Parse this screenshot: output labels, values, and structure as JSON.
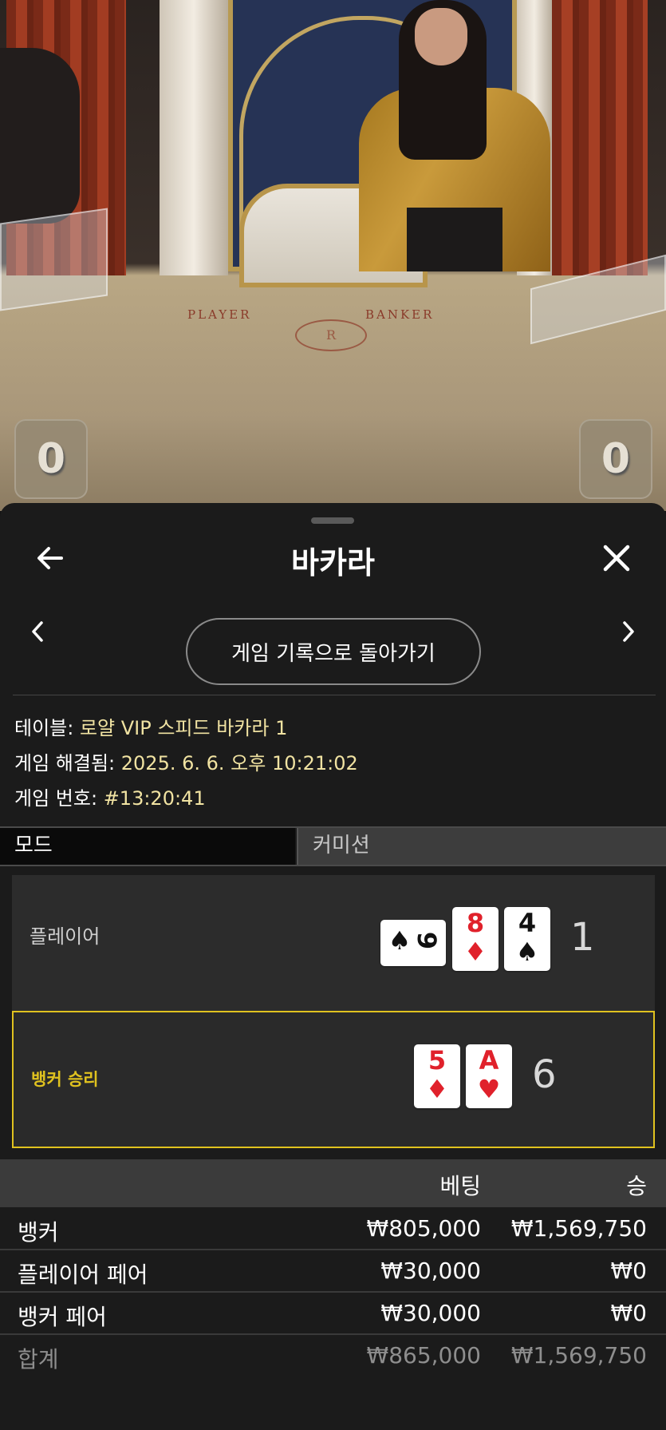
{
  "video": {
    "felt_player": "PLAYER",
    "felt_banker": "BANKER",
    "felt_logo": "R",
    "player_score": "0",
    "banker_score": "0"
  },
  "header": {
    "title": "바카라",
    "back_icon": "arrow-left-icon",
    "close_icon": "close-icon"
  },
  "navigation": {
    "prev_icon": "chevron-left-icon",
    "next_icon": "chevron-right-icon",
    "back_to_history_label": "게임 기록으로 돌아가기"
  },
  "info": {
    "table_key": "테이블:",
    "table_value": "로얄 VIP 스피드 바카라 1",
    "resolved_key": "게임 해결됨:",
    "resolved_value": "2025. 6. 6. 오후 10:21:02",
    "number_key": "게임 번호:",
    "number_value": "#13:20:41"
  },
  "tabs": {
    "mode": "모드",
    "commission": "커미션"
  },
  "hands": {
    "player": {
      "label": "플레이어",
      "score": "1",
      "cards": [
        {
          "rank": "9",
          "suit": "♠",
          "color": "#111111",
          "orientation": "sideways"
        },
        {
          "rank": "8",
          "suit": "♦",
          "color": "#e0212b"
        },
        {
          "rank": "4",
          "suit": "♠",
          "color": "#111111"
        }
      ]
    },
    "banker": {
      "label": "뱅커 승리",
      "score": "6",
      "label_color": "#e0c21f",
      "cards": [
        {
          "rank": "5",
          "suit": "♦",
          "color": "#e0212b"
        },
        {
          "rank": "A",
          "suit": "♥",
          "color": "#e0212b"
        }
      ]
    }
  },
  "bets": {
    "headers": {
      "bet": "베팅",
      "win": "승"
    },
    "rows": [
      {
        "name": "뱅커",
        "bet": "₩805,000",
        "win": "₩1,569,750"
      },
      {
        "name": "플레이어 페어",
        "bet": "₩30,000",
        "win": "₩0"
      },
      {
        "name": "뱅커 페어",
        "bet": "₩30,000",
        "win": "₩0"
      }
    ],
    "total": {
      "name": "합계",
      "bet": "₩865,000",
      "win": "₩1,569,750"
    }
  }
}
